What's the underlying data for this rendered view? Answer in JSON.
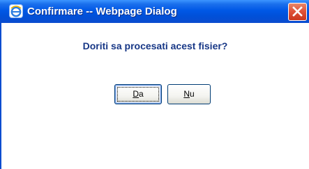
{
  "window": {
    "title": "Confirmare -- Webpage Dialog",
    "app_icon": "ie-icon",
    "close_icon": "close-icon"
  },
  "dialog": {
    "message": "Doriti sa procesati acest fisier?",
    "buttons": {
      "yes": {
        "accel": "D",
        "rest": "a"
      },
      "no": {
        "accel": "N",
        "rest": "u"
      }
    }
  },
  "colors": {
    "titlebar": "#0058e6",
    "message_text": "#173786",
    "close_button": "#e0543a"
  }
}
